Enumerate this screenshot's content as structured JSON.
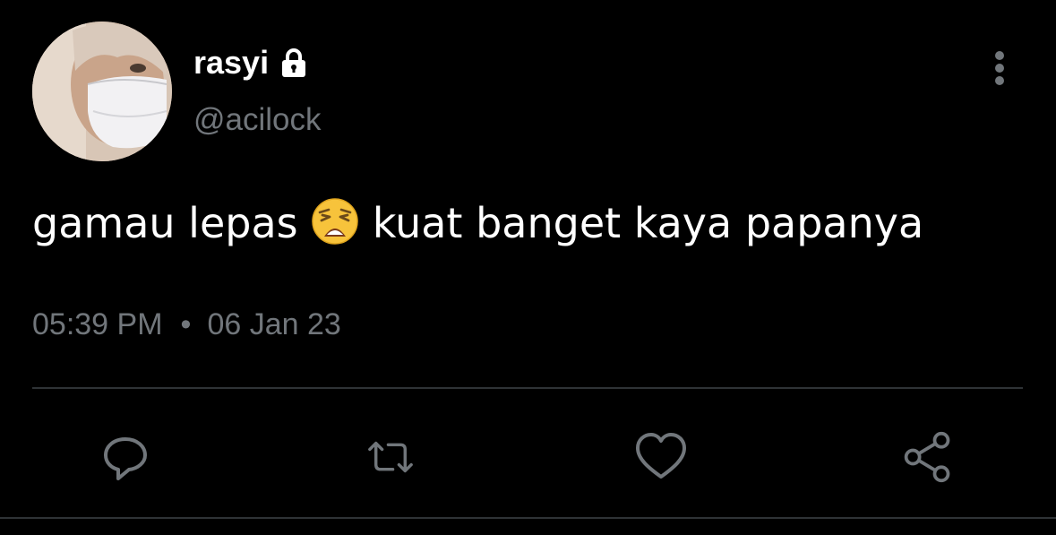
{
  "user": {
    "display_name": "rasyi",
    "handle": "@acilock",
    "avatar_icon": "avatar-photo",
    "protected_icon": "lock-icon"
  },
  "tweet": {
    "text_before_emoji": "gamau lepas",
    "emoji": "😩",
    "text_after_emoji": "kuat banget kaya papanya"
  },
  "meta": {
    "time": "05:39 PM",
    "separator": "•",
    "date": "06 Jan 23"
  },
  "actions": [
    {
      "icon": "reply-icon"
    },
    {
      "icon": "retweet-icon"
    },
    {
      "icon": "like-icon"
    },
    {
      "icon": "share-icon"
    }
  ],
  "colors": {
    "background": "#000000",
    "primary_text": "#ffffff",
    "secondary_text": "#71767b",
    "divider": "#2f3336"
  }
}
